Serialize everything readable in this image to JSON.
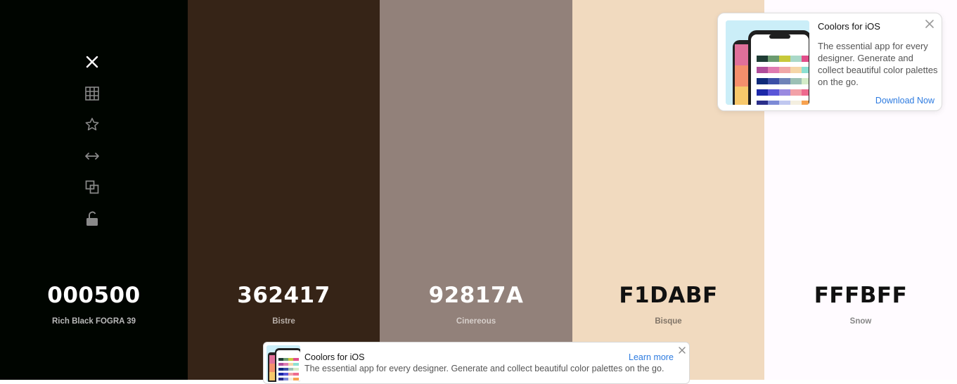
{
  "palette": {
    "colors": [
      {
        "hex": "000500",
        "name": "Rich Black FOGRA 39",
        "bg": "#000500",
        "hex_color": "#ffffff",
        "name_color": "#b9b9b9"
      },
      {
        "hex": "362417",
        "name": "Bistre",
        "bg": "#362417",
        "hex_color": "#ffffff",
        "name_color": "#b7aea8"
      },
      {
        "hex": "92817A",
        "name": "Cinereous",
        "bg": "#92817A",
        "hex_color": "#ffffff",
        "name_color": "#d7cfcb"
      },
      {
        "hex": "F1DABF",
        "name": "Bisque",
        "bg": "#F1DABF",
        "hex_color": "#111111",
        "name_color": "#807467"
      },
      {
        "hex": "FFFBFF",
        "name": "Snow",
        "bg": "#FFFBFF",
        "hex_color": "#111111",
        "name_color": "#868686"
      }
    ]
  },
  "toolbar": {
    "items": [
      {
        "icon": "close-icon"
      },
      {
        "icon": "grid-icon"
      },
      {
        "icon": "star-icon"
      },
      {
        "icon": "arrows-horizontal-icon"
      },
      {
        "icon": "copy-icon"
      },
      {
        "icon": "unlock-icon"
      }
    ]
  },
  "ad_card": {
    "title": "Coolors for iOS",
    "text": "The essential app for every designer. Generate and collect beautiful color palettes on the go.",
    "link": "Download Now"
  },
  "banner": {
    "title": "Coolors for iOS",
    "text": "The essential app for every designer. Generate and collect beautiful color palettes on the go.",
    "link": "Learn more"
  },
  "theme": {
    "accent": "#2d7be0",
    "icon_color": "#8a8a8a"
  }
}
